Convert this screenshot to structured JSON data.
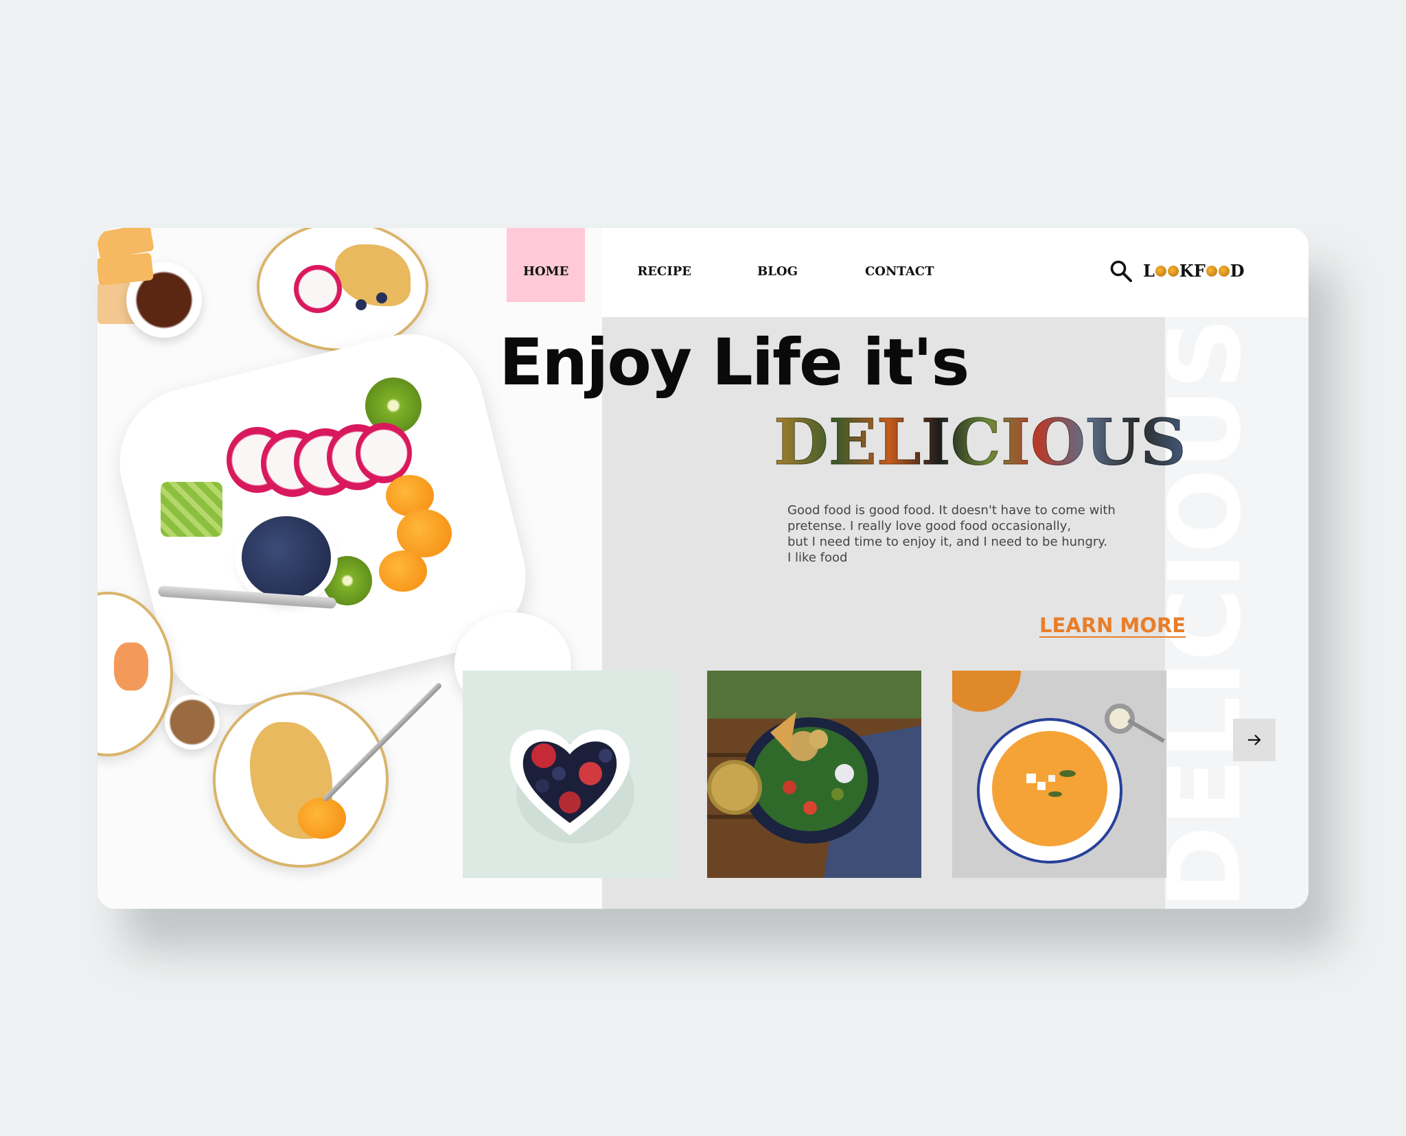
{
  "nav": {
    "items": [
      {
        "label": "HOME",
        "active": true
      },
      {
        "label": "RECIPE",
        "active": false
      },
      {
        "label": "BLOG",
        "active": false
      },
      {
        "label": "CONTACT",
        "active": false
      }
    ],
    "active_color": "#ffc9d8"
  },
  "header": {
    "search_icon": "search-icon",
    "logo": {
      "l": "L",
      "rest": "KF",
      "end": "D"
    }
  },
  "hero": {
    "headline": "Enjoy Life it's",
    "highlight": "DELICIOUS",
    "vertical_text": "DELICIOUS",
    "description": [
      "Good food is good food. It doesn't have to come with",
      "pretense. I really love good food occasionally,",
      "but I need time to enjoy it, and I need to be hungry.",
      "I like food"
    ],
    "cta": "LEARN MORE",
    "cta_color": "#e87e2a"
  },
  "gallery": {
    "thumbnails": [
      "heart-bowl-berries",
      "salad-bowl",
      "pumpkin-soup"
    ],
    "next_icon": "arrow-right-icon"
  },
  "colors": {
    "background": "#eef1f1",
    "panel": "#e4e4e4",
    "card": "#ffffff"
  }
}
